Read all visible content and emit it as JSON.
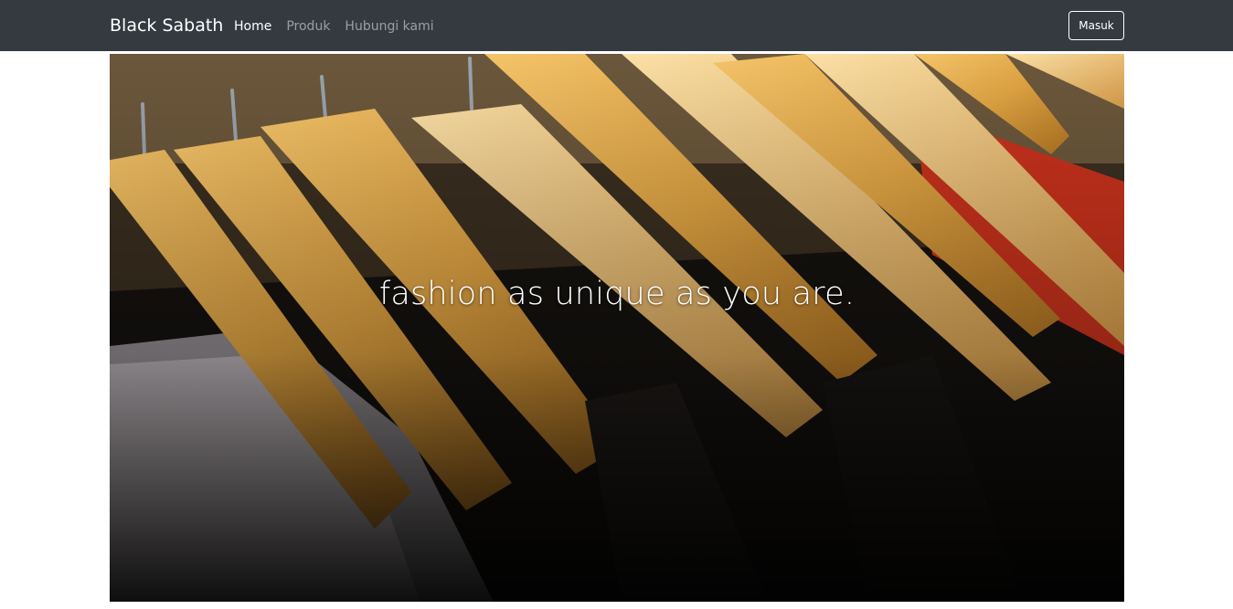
{
  "navbar": {
    "brand": "Black Sabath",
    "links": [
      {
        "label": "Home",
        "active": true
      },
      {
        "label": "Produk",
        "active": false
      },
      {
        "label": "Hubungi kami",
        "active": false
      }
    ],
    "login_label": "Masuk",
    "background_color": "#343a40"
  },
  "hero": {
    "title": "fashion as unique as you are.",
    "image_subject": "wooden clothes hangers on a rack"
  }
}
